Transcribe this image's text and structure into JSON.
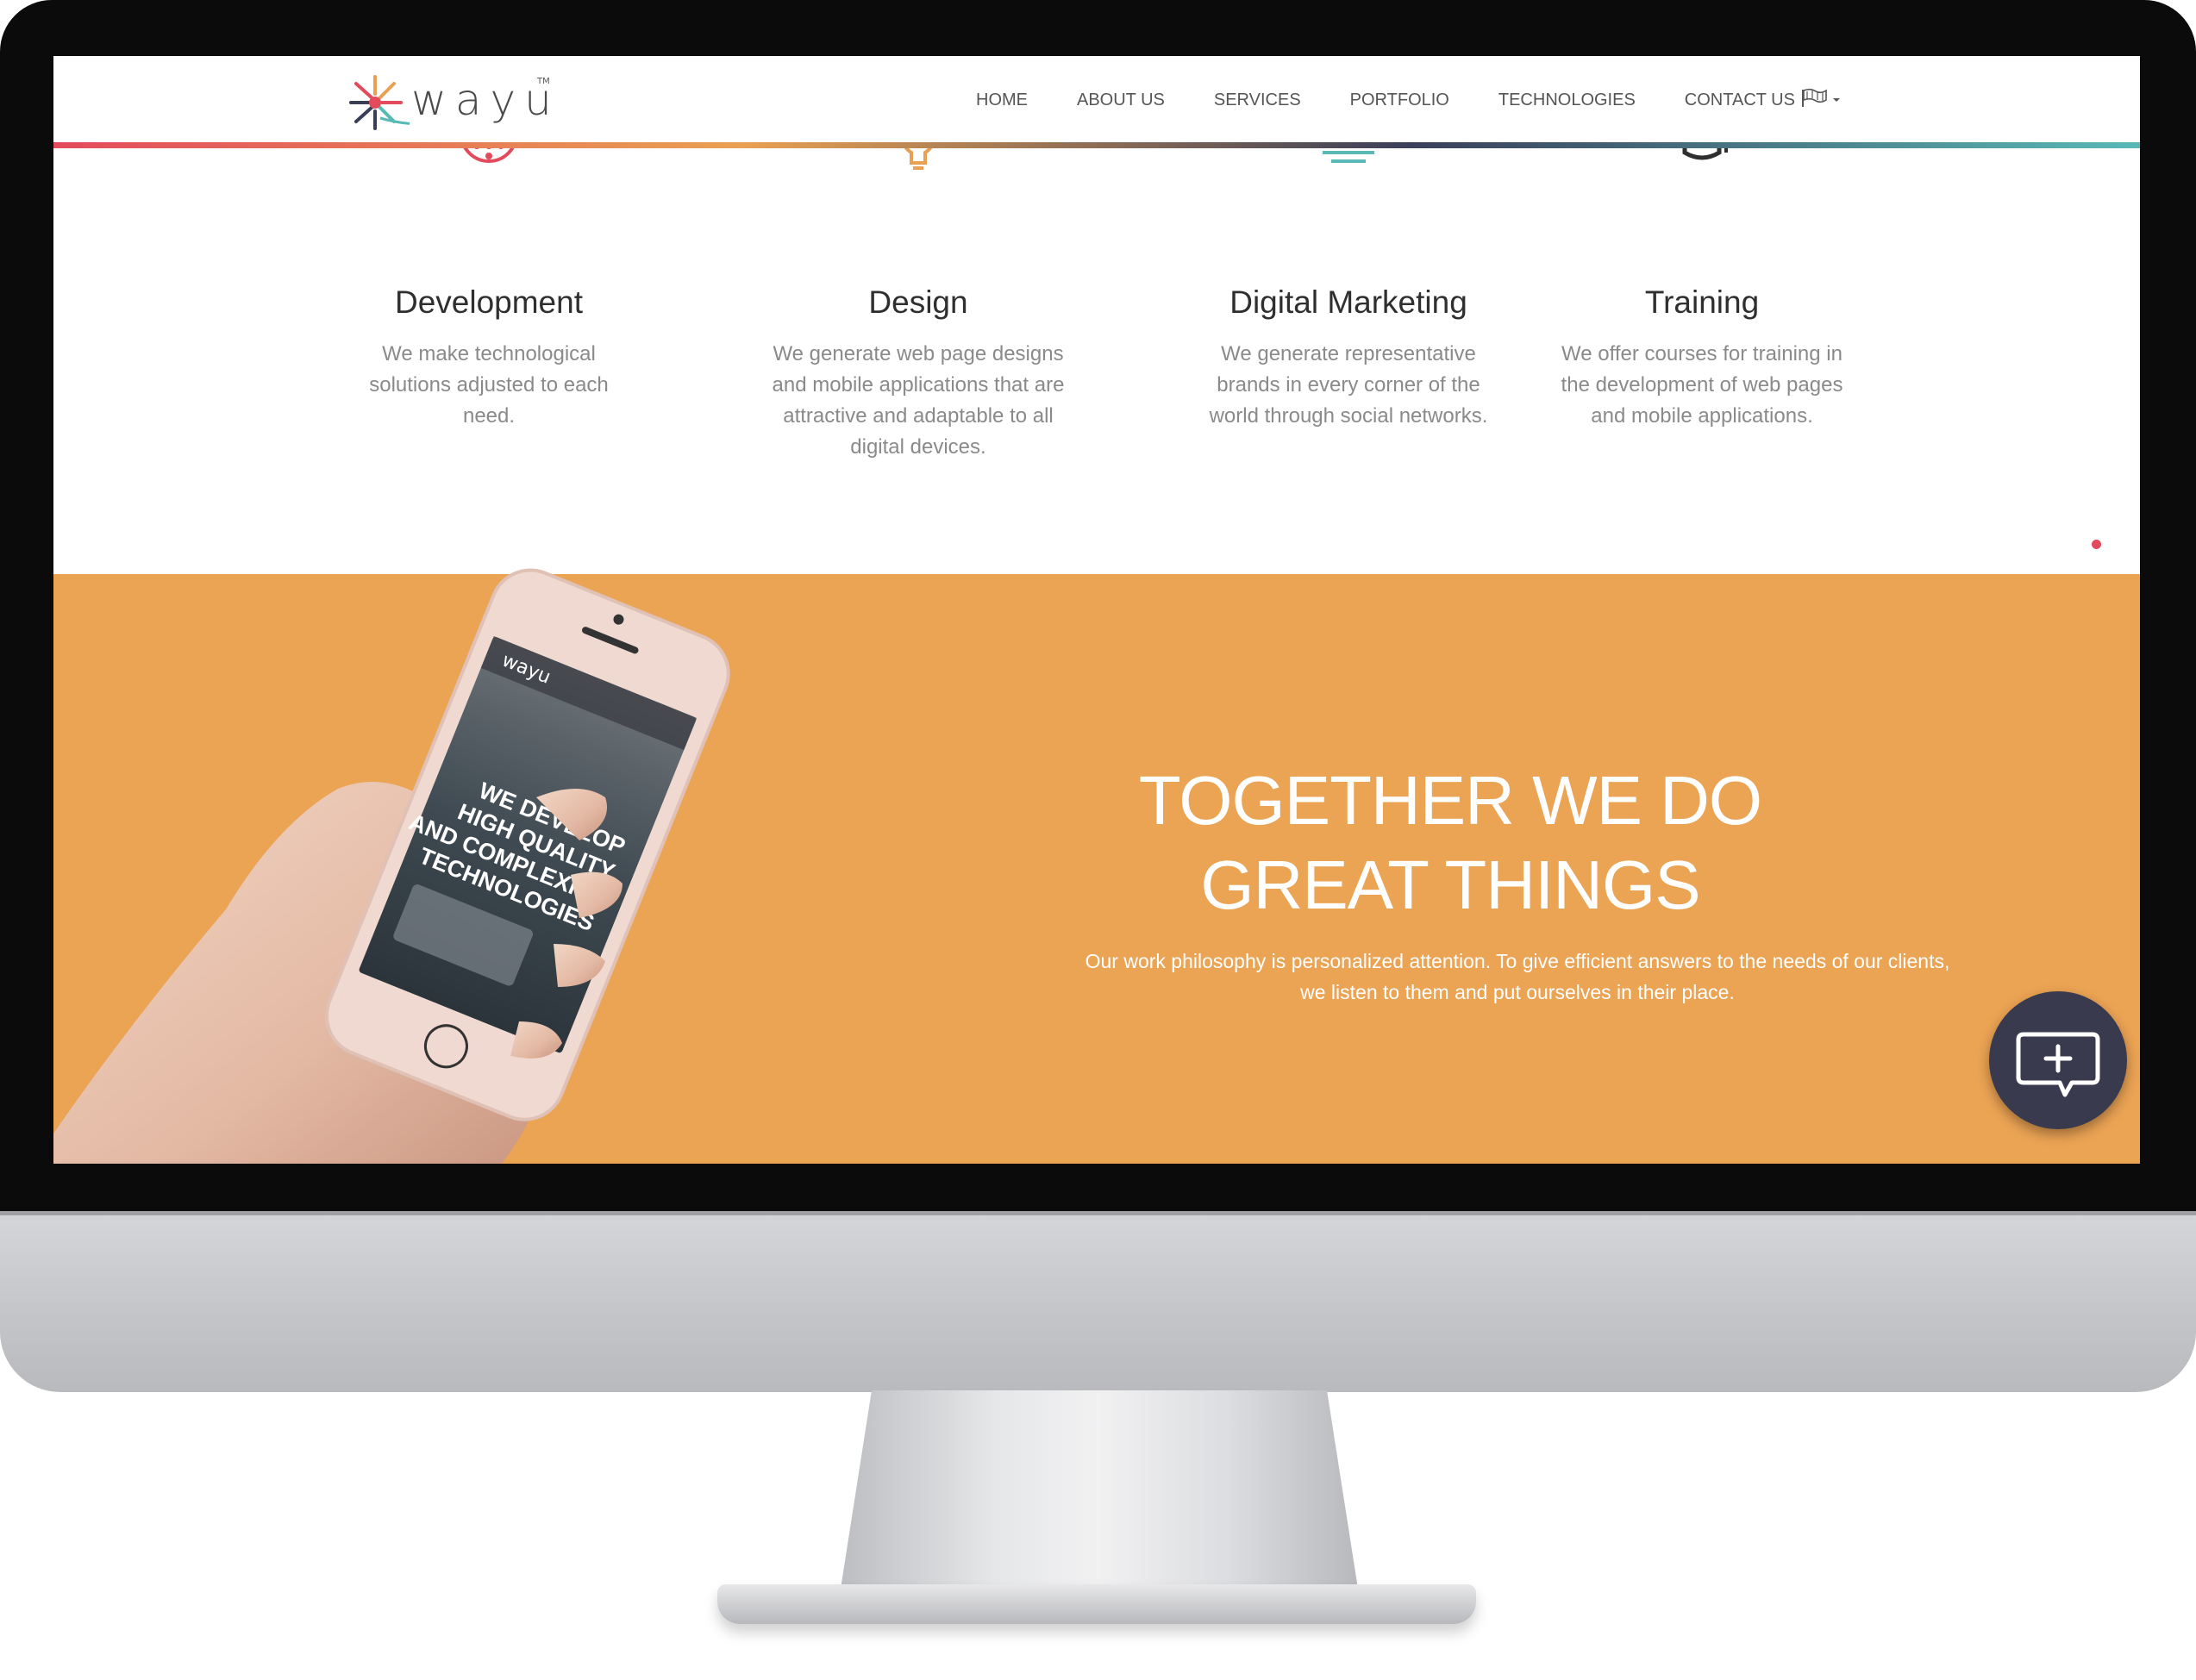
{
  "nav": {
    "logo_text": "wayu",
    "logo_tm": "TM",
    "links": [
      "HOME",
      "ABOUT US",
      "SERVICES",
      "PORTFOLIO",
      "TECHNOLOGIES",
      "CONTACT US"
    ],
    "language_icon": "flag-icon"
  },
  "services": [
    {
      "title": "Development",
      "text": "We make technological solutions adjusted to each need.",
      "icon": "chip-icon",
      "color": "#e34b5c"
    },
    {
      "title": "Design",
      "text": "We generate web page designs and mobile applications that are attractive and adaptable to all digital devices.",
      "icon": "lightbulb-icon",
      "color": "#e9a052"
    },
    {
      "title": "Digital Marketing",
      "text": "We generate representative brands in every corner of the world through social networks.",
      "icon": "sunrise-icon",
      "color": "#59b9b6"
    },
    {
      "title": "Training",
      "text": "We offer courses for training in the development of web pages and mobile applications.",
      "icon": "graduation-cap-icon",
      "color": "#2f2f2f"
    }
  ],
  "hero": {
    "title_line1": "TOGETHER WE DO",
    "title_line2": "GREAT THINGS",
    "text": "Our work philosophy is personalized attention. To give efficient answers to the needs of our clients, we listen to them and put ourselves in their place."
  },
  "phone": {
    "app_logo": "wayu",
    "screen_text": [
      "WE DEVELOP",
      "HIGH QUALITY",
      "AND COMPLEXITY",
      "TECHNOLOGIES"
    ]
  },
  "colors": {
    "accent_red": "#e34b5c",
    "accent_orange": "#eba354",
    "accent_navy": "#3a3f58",
    "accent_teal": "#59b9b6"
  }
}
